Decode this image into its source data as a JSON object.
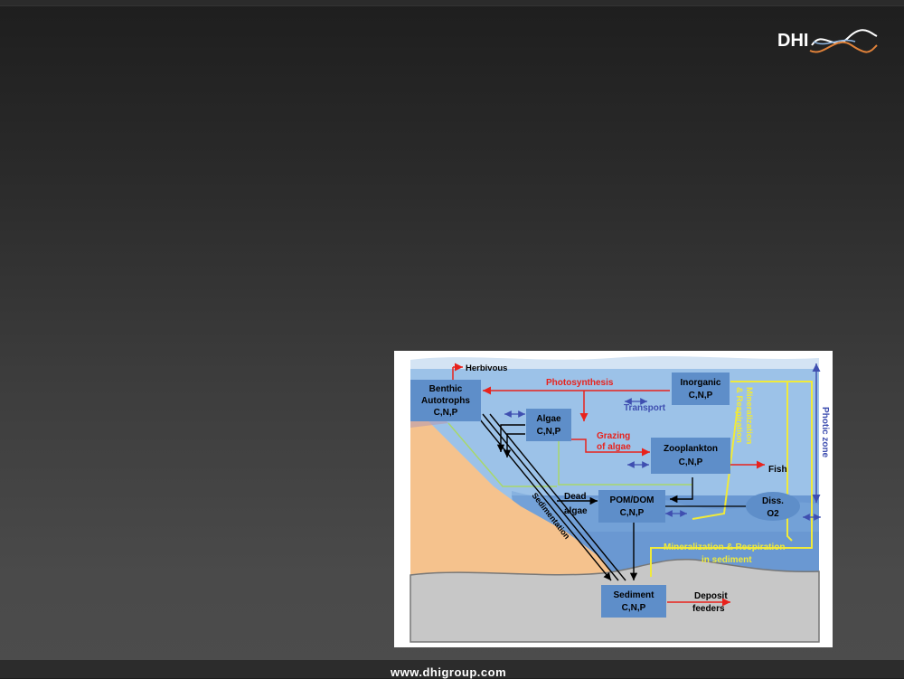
{
  "logo": {
    "text": "DHI"
  },
  "footer": {
    "url": "www.dhigroup.com"
  },
  "diagram": {
    "boxes": {
      "benthic": [
        "Benthic",
        "Autotrophs",
        "C,N,P"
      ],
      "algae": [
        "Algae",
        "C,N,P"
      ],
      "inorganic": [
        "Inorganic",
        "C,N,P"
      ],
      "zooplankton": [
        "Zooplankton",
        "C,N,P"
      ],
      "pom": [
        "POM/DOM",
        "C,N,P"
      ],
      "sediment": [
        "Sediment",
        "C,N,P"
      ],
      "diss": [
        "Diss.",
        "O2"
      ]
    },
    "labels": {
      "herbivous": "Herbivous",
      "photosynthesis": "Photosynthesis",
      "transport": "Transport",
      "grazing": [
        "Grazing",
        "of algae"
      ],
      "fish": "Fish",
      "dead_algae": [
        "Dead",
        "algae"
      ],
      "sedimentation": "Sedimentation",
      "mineralization_water": [
        "Mineralization",
        "& Respiration"
      ],
      "mineralization_sediment": [
        "Mineralization & Respiration",
        "in sediment"
      ],
      "deposit_feeders": [
        "Deposit",
        "feeders"
      ],
      "photic_zone": "Photic zone"
    },
    "colors": {
      "water_deep": "#6a98d2",
      "water_light": "#9cc2e8",
      "land": "#f5c28d",
      "sediment": "#c7c7c7",
      "box": "#5e8ec9",
      "red_flow": "#e8221c",
      "yellow_flow": "#f0ea3a",
      "green_flow": "#a8d86a",
      "transport_arrow": "#3f4fb0"
    }
  }
}
